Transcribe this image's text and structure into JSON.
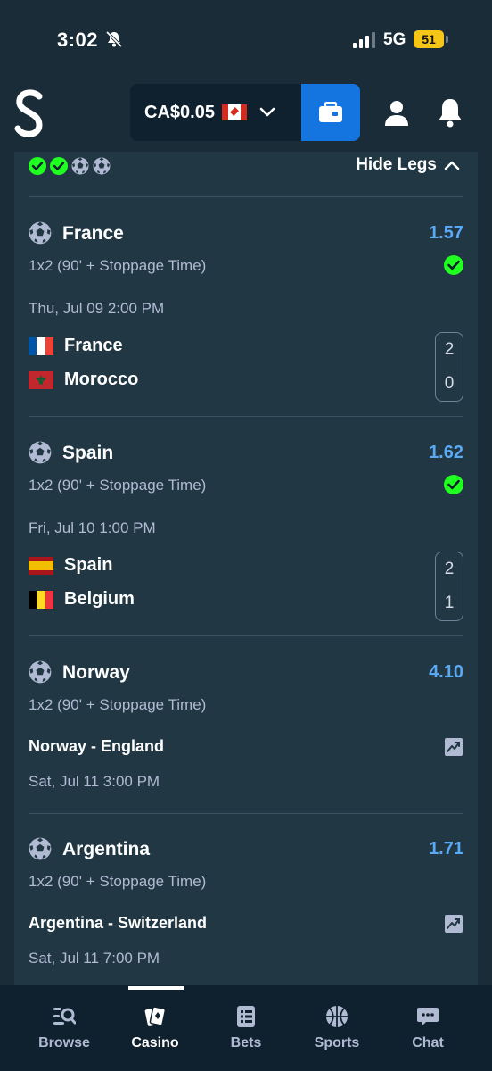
{
  "status_bar": {
    "time": "3:02",
    "network": "5G",
    "battery": "51"
  },
  "header": {
    "balance": "CA$0.05"
  },
  "card": {
    "hide_legs_label": "Hide Legs"
  },
  "legs": [
    {
      "selection": "France",
      "odds": "1.57",
      "market": "1x2 (90' + Stoppage Time)",
      "date": "Thu, Jul 09   2:00 PM",
      "teams": [
        {
          "name": "France",
          "score": "2"
        },
        {
          "name": "Morocco",
          "score": "0"
        }
      ]
    },
    {
      "selection": "Spain",
      "odds": "1.62",
      "market": "1x2 (90' + Stoppage Time)",
      "date": "Fri, Jul 10   1:00 PM",
      "teams": [
        {
          "name": "Spain",
          "score": "2"
        },
        {
          "name": "Belgium",
          "score": "1"
        }
      ]
    },
    {
      "selection": "Norway",
      "odds": "4.10",
      "market": "1x2 (90' + Stoppage Time)",
      "match": "Norway - England",
      "date": "Sat, Jul 11   3:00 PM"
    },
    {
      "selection": "Argentina",
      "odds": "1.71",
      "market": "1x2 (90' + Stoppage Time)",
      "match": "Argentina - Switzerland",
      "date": "Sat, Jul 11   7:00 PM"
    }
  ],
  "nav": [
    {
      "label": "Browse"
    },
    {
      "label": "Casino"
    },
    {
      "label": "Bets"
    },
    {
      "label": "Sports"
    },
    {
      "label": "Chat"
    }
  ],
  "colors": {
    "accent": "#1475e1",
    "odds": "#5aa9f5",
    "win": "#1fff20",
    "background": "#1a2c38"
  }
}
